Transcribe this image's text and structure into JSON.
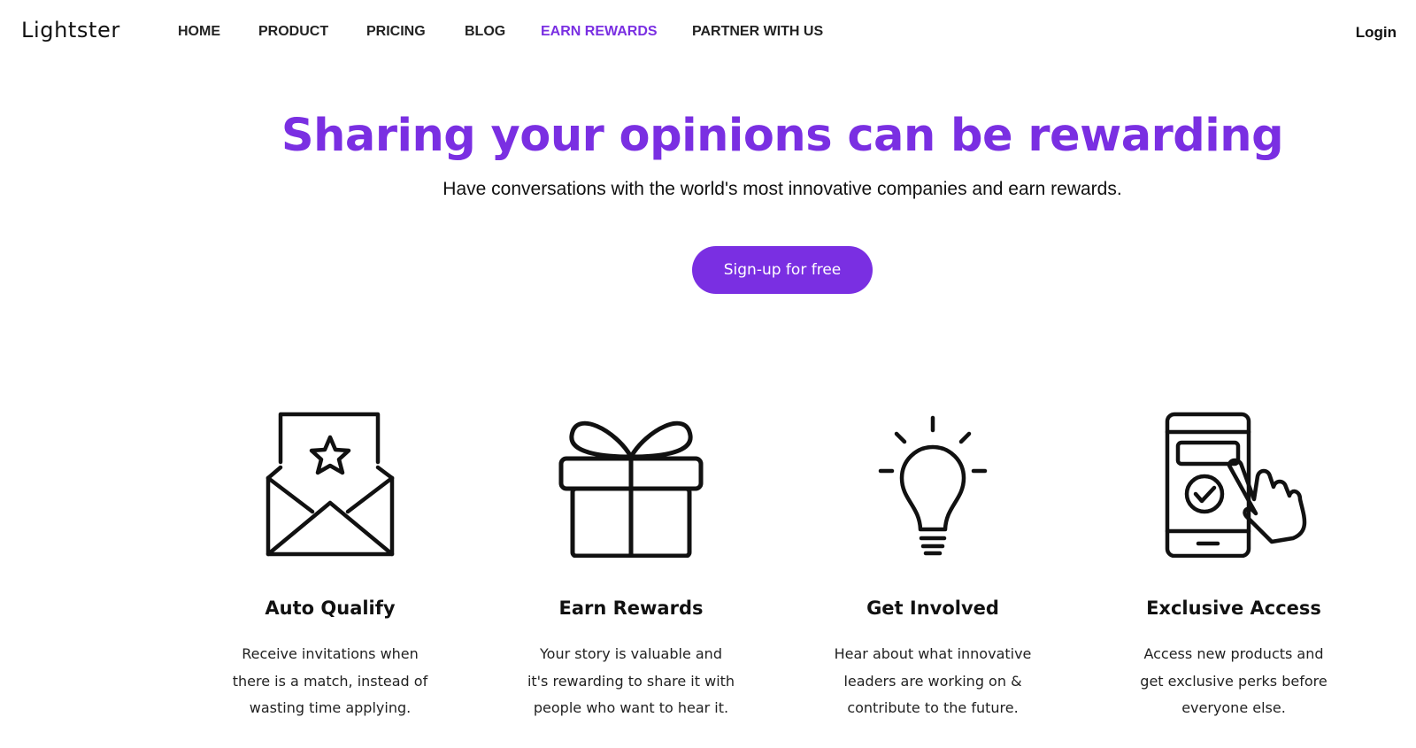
{
  "brand": {
    "logo_text": "Lightster",
    "accent_color": "#7a2fe2"
  },
  "nav": {
    "items": [
      {
        "label": "HOME",
        "active": false
      },
      {
        "label": "PRODUCT",
        "active": false
      },
      {
        "label": "PRICING",
        "active": false
      },
      {
        "label": "BLOG",
        "active": false
      },
      {
        "label": "EARN REWARDS",
        "active": true
      },
      {
        "label": "PARTNER WITH US",
        "active": false
      }
    ],
    "login_label": "Login"
  },
  "hero": {
    "title": "Sharing your opinions can be rewarding",
    "subtitle": "Have conversations with the world's most innovative companies and earn rewards.",
    "cta_label": "Sign-up for free"
  },
  "features": [
    {
      "icon": "envelope-star-icon",
      "title": "Auto Qualify",
      "desc_lines": [
        "Receive invitations when",
        "there is a match, instead of",
        "wasting time applying."
      ]
    },
    {
      "icon": "gift-icon",
      "title": "Earn Rewards",
      "desc_lines": [
        "Your story is valuable and",
        "it's rewarding to share it with",
        "people who want to hear it."
      ]
    },
    {
      "icon": "lightbulb-icon",
      "title": "Get Involved",
      "desc_lines": [
        "Hear about what innovative",
        "leaders are working on &",
        "contribute to the future."
      ]
    },
    {
      "icon": "phone-tap-icon",
      "title": "Exclusive Access",
      "desc_lines": [
        "Access new products and",
        "get exclusive perks before",
        "everyone else."
      ]
    }
  ]
}
